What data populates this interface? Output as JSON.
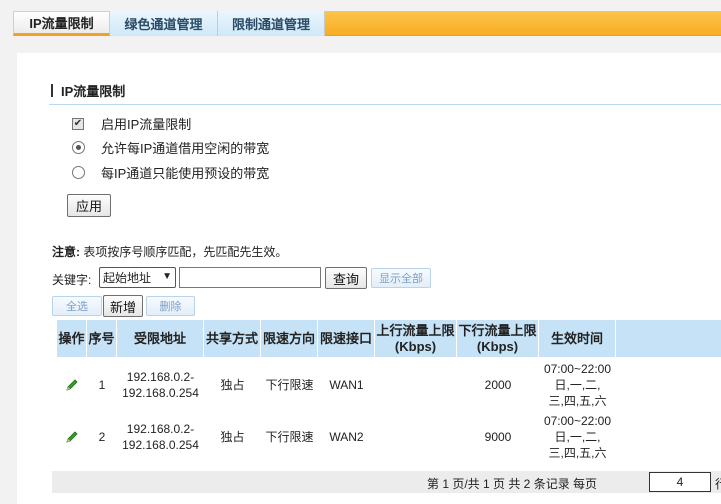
{
  "tabs": [
    {
      "label": "IP流量限制"
    },
    {
      "label": "绿色通道管理"
    },
    {
      "label": "限制通道管理"
    }
  ],
  "section_title": "IP流量限制",
  "options": {
    "enable_label": "启用IP流量限制",
    "enable_checked": true,
    "radio_borrow_label": "允许每IP通道借用空闲的带宽",
    "radio_preset_label": "每IP通道只能使用预设的带宽",
    "selected": "borrow"
  },
  "apply_label": "应用",
  "note_prefix": "注意:",
  "note_text": "表项按序号顺序匹配，先匹配先生效。",
  "search": {
    "keyword_label": "关键字:",
    "field_selected": "起始地址",
    "input_value": "",
    "query_label": "查询",
    "show_all_label": "显示全部"
  },
  "actions": {
    "select_all": "全选",
    "add_new": "新增",
    "delete": "删除"
  },
  "table": {
    "headers": [
      "操作",
      "序号",
      "受限地址",
      "共享方式",
      "限速方向",
      "限速接口",
      "上行流量上限\n(Kbps)",
      "下行流量上限\n(Kbps)",
      "生效时间"
    ],
    "rows": [
      {
        "index": "1",
        "addr1": "192.168.0.2-",
        "addr2": "192.168.0.254",
        "share": "独占",
        "direction": "下行限速",
        "iface": "WAN1",
        "up": "",
        "down": "2000",
        "time1": "07:00~22:00",
        "time2": "日,一,二,",
        "time3": "三,四,五,六"
      },
      {
        "index": "2",
        "addr1": "192.168.0.2-",
        "addr2": "192.168.0.254",
        "share": "独占",
        "direction": "下行限速",
        "iface": "WAN2",
        "up": "",
        "down": "9000",
        "time1": "07:00~22:00",
        "time2": "日,一,二,",
        "time3": "三,四,五,六"
      }
    ]
  },
  "pager": {
    "summary": "第 1 页/共 1 页 共 2 条记录 每页",
    "per_page": "4",
    "tail": "行"
  },
  "colors": {
    "accent_orange": "#f8ad25",
    "header_blue": "#c5e2f6",
    "edit_green": "#3a9a2a"
  }
}
